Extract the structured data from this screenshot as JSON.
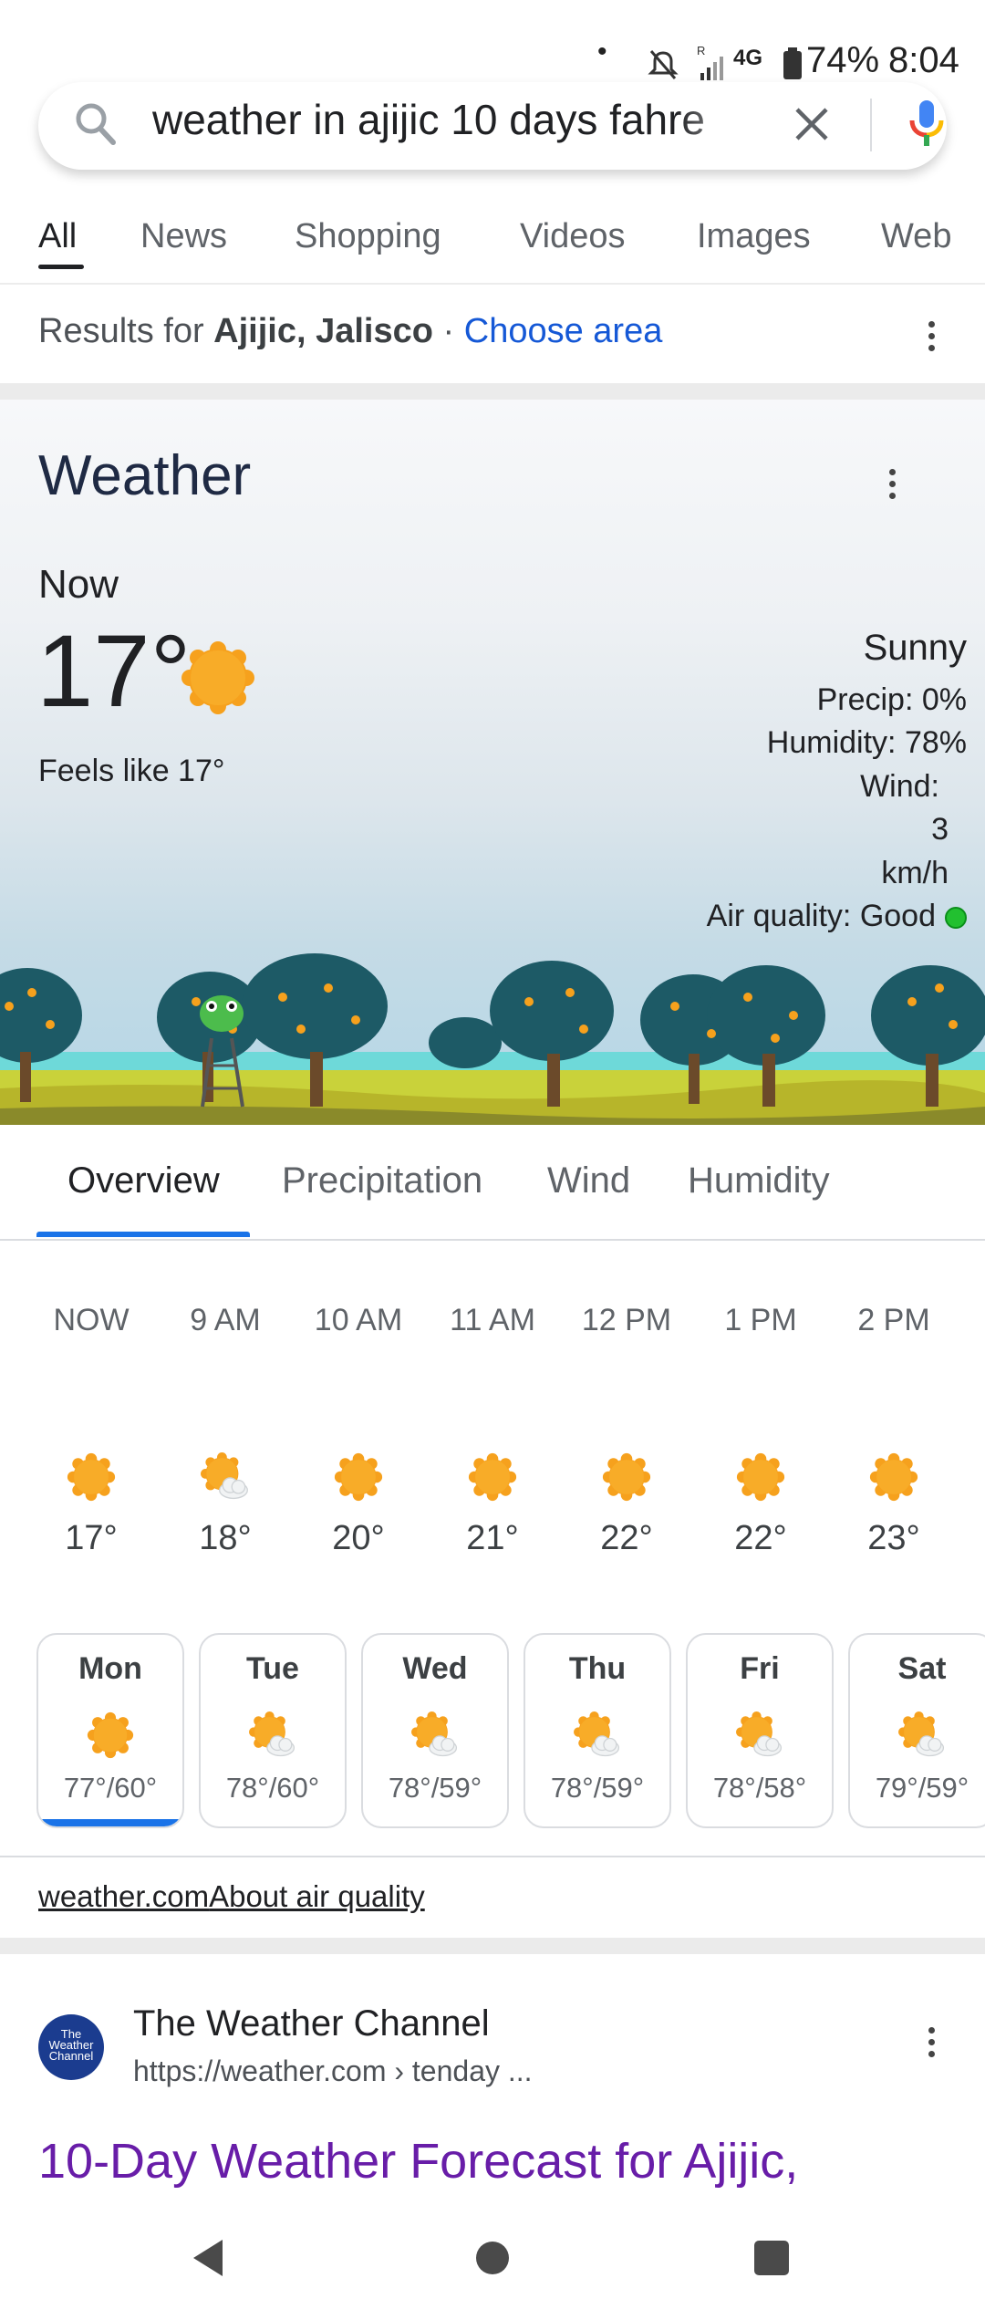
{
  "status_bar": {
    "battery": "74%",
    "time": "8:04",
    "network": "4G"
  },
  "search": {
    "query": "weather in ajijic 10 days fahre"
  },
  "tabs": [
    "All",
    "News",
    "Shopping",
    "Videos",
    "Images",
    "Web"
  ],
  "results_for": {
    "prefix": "Results for ",
    "location": "Ajijic, Jalisco",
    "sep": " · ",
    "link": "Choose area"
  },
  "weather": {
    "title": "Weather",
    "now_label": "Now",
    "temperature": "17°",
    "feels_like": "Feels like 17°",
    "condition": "Sunny",
    "precip": "Precip: 0%",
    "humidity": "Humidity: 78%",
    "wind_label": "Wind:",
    "wind_value": "3",
    "wind_unit": "km/h",
    "air_quality": "Air quality: Good",
    "accent_color": "#1a73e8",
    "sun_color": "#f29900"
  },
  "forecast_tabs": [
    "Overview",
    "Precipitation",
    "Wind",
    "Humidity"
  ],
  "hourly": [
    {
      "time": "NOW",
      "temp": "17°",
      "icon": "sun-icon"
    },
    {
      "time": "9 AM",
      "temp": "18°",
      "icon": "partly-cloudy-icon"
    },
    {
      "time": "10 AM",
      "temp": "20°",
      "icon": "sun-icon"
    },
    {
      "time": "11 AM",
      "temp": "21°",
      "icon": "sun-icon"
    },
    {
      "time": "12 PM",
      "temp": "22°",
      "icon": "sun-icon"
    },
    {
      "time": "1 PM",
      "temp": "22°",
      "icon": "sun-icon"
    },
    {
      "time": "2 PM",
      "temp": "23°",
      "icon": "sun-icon"
    }
  ],
  "daily": [
    {
      "day": "Mon",
      "range": "77°/60°",
      "icon": "sun-icon"
    },
    {
      "day": "Tue",
      "range": "78°/60°",
      "icon": "partly-cloudy-icon"
    },
    {
      "day": "Wed",
      "range": "78°/59°",
      "icon": "partly-cloudy-icon"
    },
    {
      "day": "Thu",
      "range": "78°/59°",
      "icon": "partly-cloudy-icon"
    },
    {
      "day": "Fri",
      "range": "78°/58°",
      "icon": "partly-cloudy-icon"
    },
    {
      "day": "Sat",
      "range": "79°/59°",
      "icon": "partly-cloudy-icon"
    }
  ],
  "footer": {
    "source": "weather.com",
    "air_quality_link": "About air quality"
  },
  "result": {
    "site_name": "The Weather Channel",
    "url": "https://weather.com › tenday ...",
    "title": "10-Day Weather Forecast for Ajijic,",
    "logo_text": "The Weather Channel"
  }
}
